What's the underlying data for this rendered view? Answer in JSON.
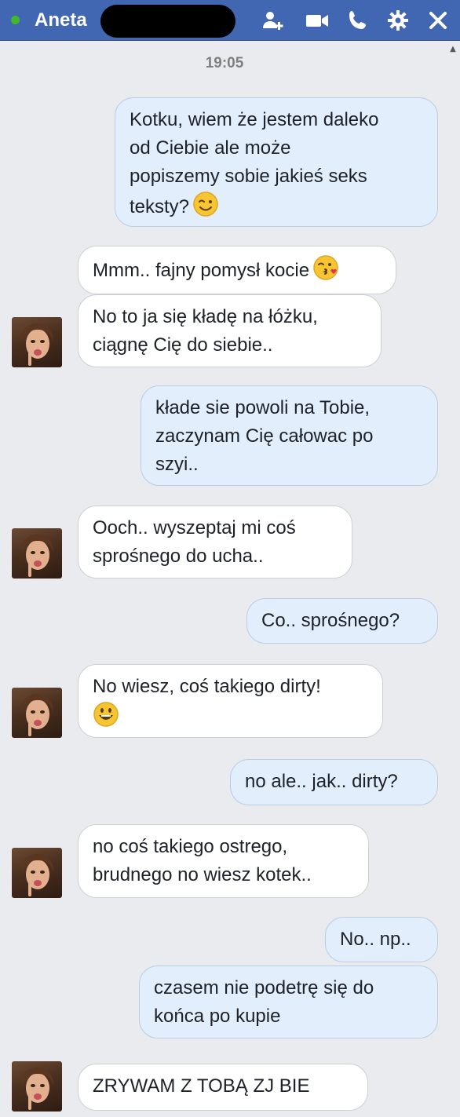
{
  "header": {
    "contact_name": "Aneta",
    "icons": [
      "add-people-icon",
      "video-call-icon",
      "phone-icon",
      "gear-icon",
      "close-icon"
    ],
    "online_color": "#42b72a",
    "bar_color": "#4267b2"
  },
  "thread": {
    "timestamp": "19:05",
    "messages": [
      {
        "side": "out",
        "text": "Kotku, wiem że jestem daleko\nod Ciebie ale może\npopiszemy sobie jakieś seks\nteksty?",
        "emoji": "wink-emoji-icon"
      },
      {
        "side": "in",
        "text": "Mmm.. fajny pomysł kocie",
        "emoji": "kiss-emoji-icon"
      },
      {
        "side": "in",
        "text": "No to ja się kładę na łóżku,\nciągnę Cię do siebie.."
      },
      {
        "side": "out",
        "text": "kłade sie powoli na Tobie,\nzaczynam Cię całowac po\nszyi.."
      },
      {
        "side": "in",
        "text": "Ooch.. wyszeptaj mi coś\nsprośnego do ucha.."
      },
      {
        "side": "out",
        "text": "Co.. sprośnego?"
      },
      {
        "side": "in",
        "text": "No wiesz, coś takiego dirty!",
        "emoji": "grin-emoji-icon"
      },
      {
        "side": "out",
        "text": "no ale.. jak.. dirty?"
      },
      {
        "side": "in",
        "text": "no coś takiego ostrego,\nbrudnego no wiesz kotek.."
      },
      {
        "side": "out",
        "text": "No.. np.."
      },
      {
        "side": "out",
        "text": "czasem nie podetrę się do\nkońca po kupie"
      },
      {
        "side": "in",
        "text": "ZRYWAM Z TOBĄ ZJ  BIE"
      }
    ]
  }
}
